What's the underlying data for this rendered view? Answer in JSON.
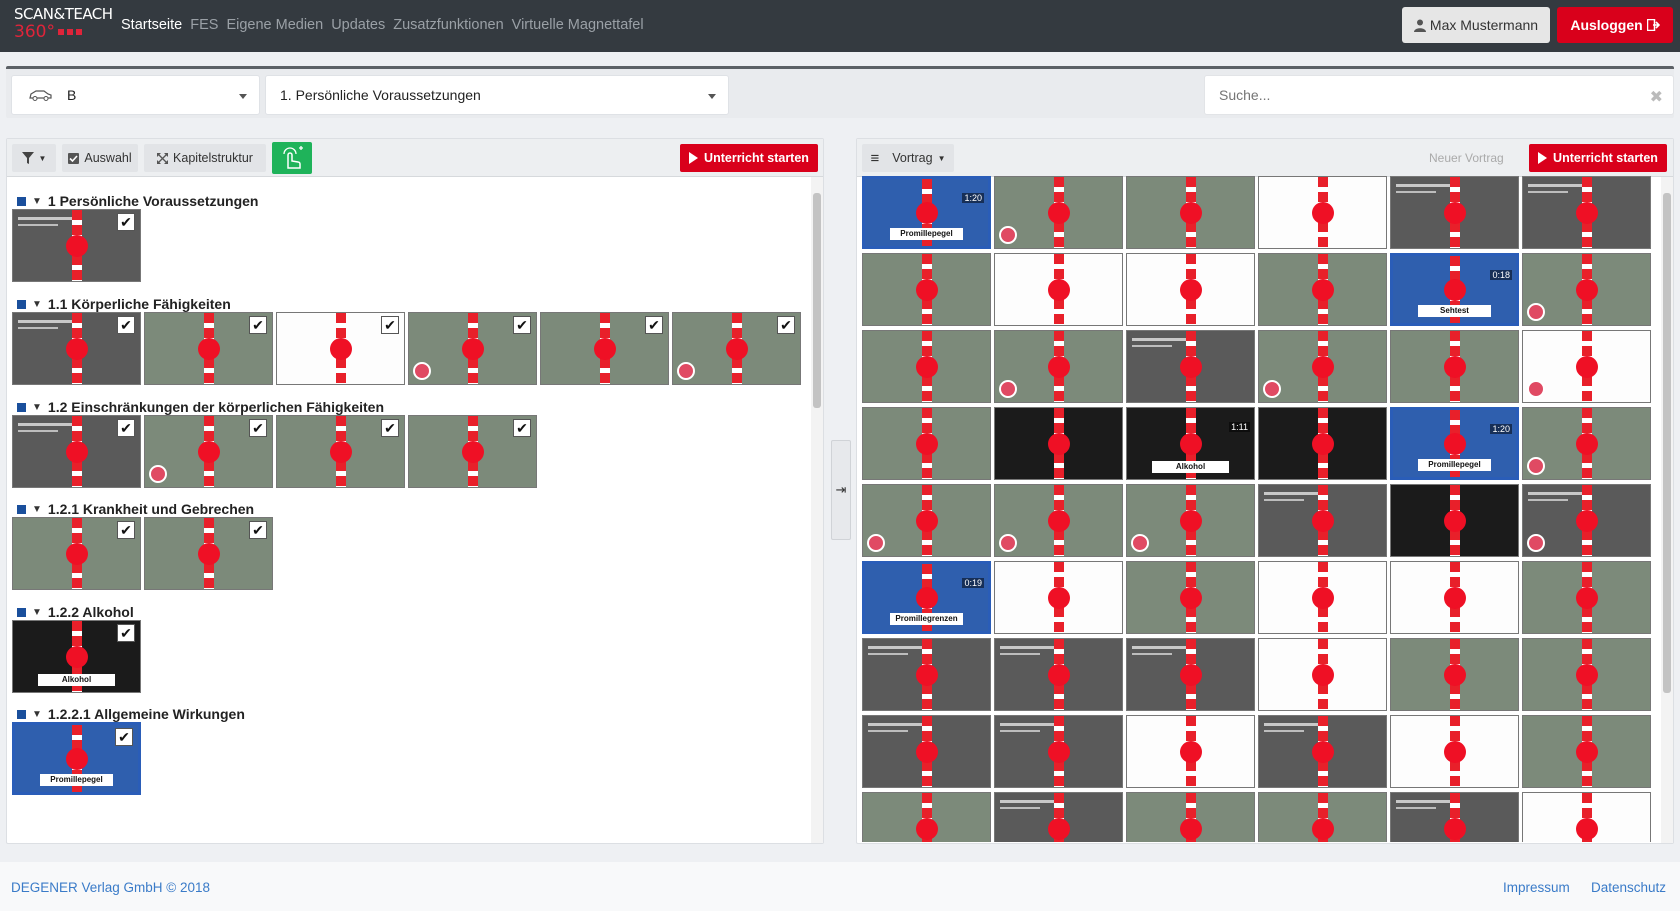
{
  "header": {
    "logo_line1": "SCAN&TEACH",
    "logo_line2": "360°",
    "nav": [
      "Startseite",
      "FES",
      "Eigene Medien",
      "Updates",
      "Zusatzfunktionen",
      "Virtuelle Magnettafel"
    ],
    "active_nav": "Startseite",
    "user_label": "Max Mustermann",
    "logout_label": "Ausloggen"
  },
  "selectors": {
    "class_value": "B",
    "chapter_value": "1. Persönliche Voraussetzungen",
    "search_placeholder": "Suche..."
  },
  "left_panel": {
    "toolbar": {
      "selection_label": "Auswahl",
      "structure_label": "Kapitelstruktur",
      "start_label": "Unterricht starten"
    },
    "chapters": [
      {
        "title": "1 Persönliche Voraussetzungen",
        "thumbs": [
          {
            "type": "slide",
            "checked": true
          }
        ]
      },
      {
        "title": "1.1 Körperliche Fähigkeiten",
        "thumbs": [
          {
            "type": "slide",
            "checked": true
          },
          {
            "type": "photo",
            "checked": true
          },
          {
            "type": "white",
            "checked": true
          },
          {
            "type": "photo",
            "checked": true
          },
          {
            "type": "photo",
            "checked": true
          },
          {
            "type": "photo",
            "checked": true
          }
        ]
      },
      {
        "title": "1.2 Einschränkungen der körperlichen Fähigkeiten",
        "thumbs": [
          {
            "type": "slide",
            "checked": true
          },
          {
            "type": "photo",
            "checked": true
          },
          {
            "type": "photo",
            "checked": true
          },
          {
            "type": "photo",
            "checked": true
          }
        ]
      },
      {
        "title": "1.2.1 Krankheit und Gebrechen",
        "thumbs": [
          {
            "type": "photo",
            "checked": true
          },
          {
            "type": "photo",
            "checked": true
          }
        ]
      },
      {
        "title": "1.2.2 Alkohol",
        "thumbs": [
          {
            "type": "dark",
            "checked": true,
            "label": "Alkohol"
          }
        ]
      },
      {
        "title": "1.2.2.1 Allgemeine Wirkungen",
        "thumbs": [
          {
            "type": "video",
            "checked": true,
            "label": "Promillepegel"
          }
        ]
      }
    ]
  },
  "right_panel": {
    "toolbar": {
      "lecture_label": "Vortrag",
      "new_lecture_label": "Neuer Vortrag",
      "start_label": "Unterricht starten"
    },
    "labels": {
      "promillepegel": "Promillepegel",
      "sehtest": "Sehtest",
      "alkohol": "Alkohol",
      "promillegrenzen": "Promillegrenzen",
      "dur_120": "1:20",
      "dur_018": "0:18",
      "dur_111": "1:11",
      "dur_019": "0:19"
    }
  },
  "footer": {
    "copyright": "DEGENER Verlag GmbH © 2018",
    "imprint": "Impressum",
    "privacy": "Datenschutz"
  }
}
